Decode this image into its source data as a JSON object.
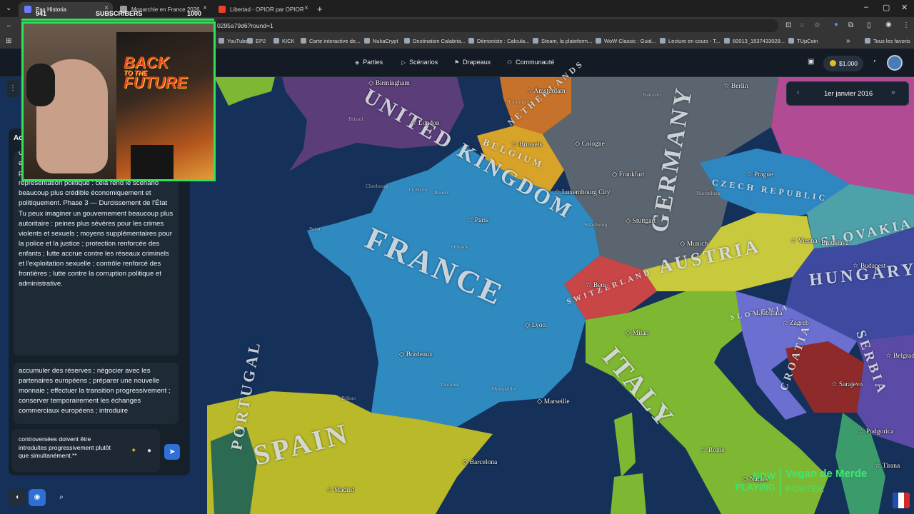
{
  "browser": {
    "tabs": [
      {
        "title": "Pax Historia",
        "color": "#6d7bff"
      },
      {
        "title": "Monarchie en France 2026",
        "color": "#9b9b9b"
      },
      {
        "title": "Libertad - OPIOR par OPIOR",
        "color": "#e8422d"
      }
    ],
    "url": "0295a79d6?round=1",
    "bookmarks": [
      "YouTube",
      "EP2",
      "KICK",
      "Carte interactive de...",
      "NukaCrypt",
      "Destination Calabria...",
      "Démoniste : Calcula...",
      "Steam, la plateform...",
      "WoW Classic : Guid...",
      "Lecture en cours - T...",
      "60013_1537433028...",
      "TUpCoin",
      "Tous les favoris"
    ]
  },
  "nav": {
    "parties": "Parties",
    "scenarios": "Scénarios",
    "drapeaux": "Drapeaux",
    "communaute": "Communauté",
    "money": "$1.000"
  },
  "date": "1er janvier 2016",
  "stream": {
    "subscribers_label": "SUBSCRIBERS",
    "sub_count": "941",
    "sub_goal": "1000",
    "poster_line1": "BACK",
    "poster_line2": "TO THE",
    "poster_line3": "FUTURE"
  },
  "chat": {
    "panel_header": "Ac",
    "message1": "Constitution donnant davantage de pouvoirs exécutifs au souverain. Réorganiser le Parlement plutôt que simplement supprimer toute représentation politique : cela rend le scénario beaucoup plus crédible économiquement et politiquement. Phase 3 — Durcissement de l'État Tu peux imaginer un gouvernement beaucoup plus autoritaire : peines plus sévères pour les crimes violents et sexuels ; moyens supplémentaires pour la police et la justice ; protection renforcée des enfants ; lutte accrue contre les réseaux criminels et l'exploitation sexuelle ; contrôle renforcé des frontières ; lutte contre la corruption politique et administrative.",
    "message2": "accumuler des réserves ; négocier avec les partenaires européens ; préparer une nouvelle monnaie ; effectuer la transition progressivement ; conserver temporairement les échanges commerciaux européens ; introduire",
    "composer_text": "controversées doivent être introduites progressivement plutôt que simultanément.**"
  },
  "now_playing": {
    "label": "NOW PLAYING",
    "title": "Vegan de Merde",
    "artist": "POKTEK"
  },
  "map": {
    "countries": [
      "FRANCE",
      "GERMANY",
      "AUSTRIA",
      "HUNGARY",
      "ITALY",
      "SPAIN",
      "BELGIUM",
      "NETHERLANDS",
      "SWITZERLAND",
      "SLOVAKIA",
      "CZECH REPUBLIC",
      "CROATIA",
      "SERBIA",
      "SLOVENIA",
      "UNITED KINGDOM",
      "PORTUGAL"
    ],
    "cities": [
      "Birmingham",
      "London",
      "Amsterdam",
      "Berlin",
      "Brussels",
      "Cologne",
      "Frankfurt",
      "Luxembourg City",
      "Prague",
      "Paris",
      "Stuttgart",
      "Munich",
      "Vienna",
      "Bratislava",
      "Budapest",
      "Bern",
      "Ljubljana",
      "Zagreb",
      "Milan",
      "Lyon",
      "Bordeaux",
      "Marseille",
      "Barcelona",
      "Madrid",
      "Rome",
      "Naples",
      "Sarajevo",
      "Podgorica",
      "Tirana",
      "Belgrade"
    ],
    "minor_cities": [
      "Cherbourg",
      "Le Havre",
      "Rouen",
      "Orléans",
      "Brest",
      "Toulouse",
      "Montpellier",
      "Bilbao",
      "Strasbourg",
      "Nuremberg",
      "Bristol",
      "Rotterdam",
      "Hanover"
    ]
  }
}
